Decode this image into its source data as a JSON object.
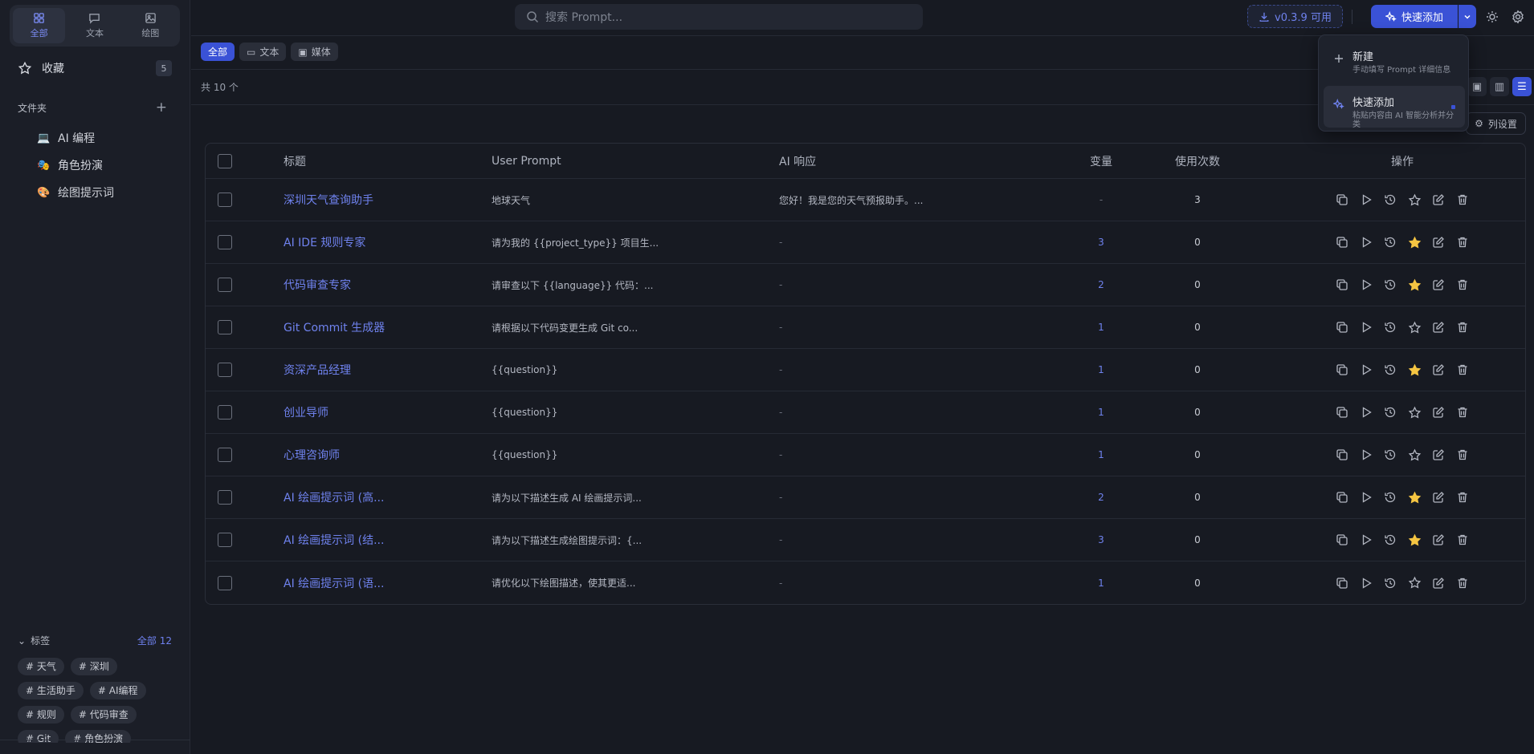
{
  "sidebar": {
    "segments": [
      {
        "label": "全部",
        "icon": "grid-icon",
        "active": true
      },
      {
        "label": "文本",
        "icon": "chat-icon",
        "active": false
      },
      {
        "label": "绘图",
        "icon": "image-icon",
        "active": false
      }
    ],
    "favorites": {
      "label": "收藏",
      "count": "5"
    },
    "folders_title": "文件夹",
    "folders": [
      {
        "label": "AI 编程",
        "icon": "laptop-icon"
      },
      {
        "label": "角色扮演",
        "icon": "masks-icon"
      },
      {
        "label": "绘图提示词",
        "icon": "palette-icon"
      }
    ],
    "tags_title": "标签",
    "tags_all": "全部 12",
    "tags": [
      "# 天气",
      "# 深圳",
      "# 生活助手",
      "# AI编程",
      "# 规则",
      "# 代码审查",
      "# Git",
      "# 角色扮演"
    ]
  },
  "topbar": {
    "search_placeholder": "搜索 Prompt...",
    "version": "v0.3.9 可用",
    "quick_add": "快速添加"
  },
  "filters": [
    {
      "label": "全部",
      "active": true
    },
    {
      "label": "文本",
      "active": false
    },
    {
      "label": "媒体",
      "active": false
    }
  ],
  "total": "共 10 个",
  "column_settings": "列设置",
  "table": {
    "headers": {
      "title": "标题",
      "prompt": "User Prompt",
      "response": "AI 响应",
      "vars": "变量",
      "uses": "使用次数",
      "actions": "操作"
    },
    "rows": [
      {
        "title": "深圳天气查询助手",
        "prompt": "地球天气",
        "response": "您好！我是您的天气预报助手。...",
        "vars": "-",
        "uses": "3",
        "starred": false
      },
      {
        "title": "AI IDE 规则专家",
        "prompt": "请为我的 {{project_type}} 项目生...",
        "response": "-",
        "vars": "3",
        "uses": "0",
        "starred": true
      },
      {
        "title": "代码审查专家",
        "prompt": "请审查以下 {{language}} 代码：...",
        "response": "-",
        "vars": "2",
        "uses": "0",
        "starred": true
      },
      {
        "title": "Git Commit 生成器",
        "prompt": "请根据以下代码变更生成 Git co...",
        "response": "-",
        "vars": "1",
        "uses": "0",
        "starred": false
      },
      {
        "title": "资深产品经理",
        "prompt": "{{question}}",
        "response": "-",
        "vars": "1",
        "uses": "0",
        "starred": true
      },
      {
        "title": "创业导师",
        "prompt": "{{question}}",
        "response": "-",
        "vars": "1",
        "uses": "0",
        "starred": false
      },
      {
        "title": "心理咨询师",
        "prompt": "{{question}}",
        "response": "-",
        "vars": "1",
        "uses": "0",
        "starred": false
      },
      {
        "title": "AI 绘画提示词 (高...",
        "prompt": "请为以下描述生成 AI 绘画提示词...",
        "response": "-",
        "vars": "2",
        "uses": "0",
        "starred": true
      },
      {
        "title": "AI 绘画提示词 (结...",
        "prompt": "请为以下描述生成绘图提示词：{...",
        "response": "-",
        "vars": "3",
        "uses": "0",
        "starred": true
      },
      {
        "title": "AI 绘画提示词 (语...",
        "prompt": "请优化以下绘图描述，使其更适...",
        "response": "-",
        "vars": "1",
        "uses": "0",
        "starred": false
      }
    ]
  },
  "menu": {
    "items": [
      {
        "title": "新建",
        "desc": "手动填写 Prompt 详细信息"
      },
      {
        "title": "快速添加",
        "desc": "粘贴内容由 AI 智能分析并分类"
      }
    ]
  },
  "colors": {
    "accent": "#3a52d6",
    "link": "#6f82ee",
    "star": "#f5c542",
    "bg": "#171a22"
  }
}
